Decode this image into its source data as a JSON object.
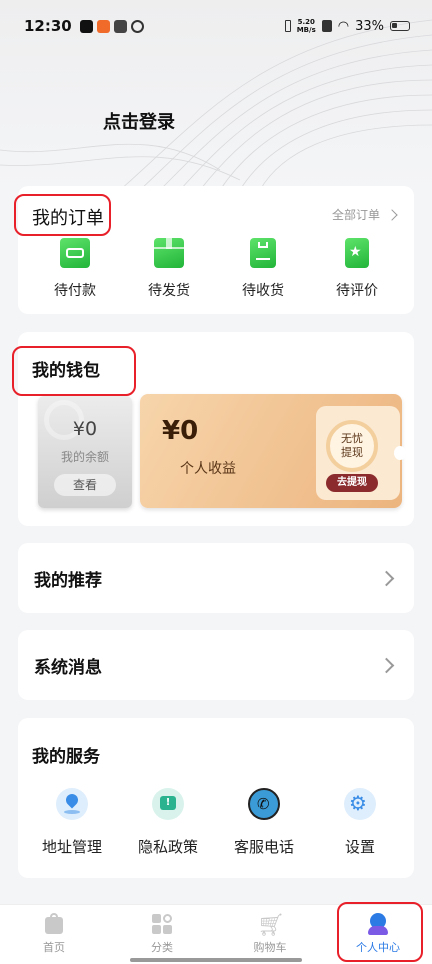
{
  "status_bar": {
    "time": "12:30",
    "net_speed_value": "5.20",
    "net_speed_unit": "MB/s",
    "battery": "33%"
  },
  "header": {
    "login": "点击登录"
  },
  "orders": {
    "title": "我的订单",
    "all_link": "全部订单",
    "items": [
      {
        "label": "待付款",
        "icon": "wallet-icon"
      },
      {
        "label": "待发货",
        "icon": "box-icon"
      },
      {
        "label": "待收货",
        "icon": "package-receive-icon"
      },
      {
        "label": "待评价",
        "icon": "star-review-icon"
      }
    ]
  },
  "wallet": {
    "title": "我的钱包",
    "balance_amount": "¥0",
    "balance_label": "我的余额",
    "balance_button": "查看",
    "income_amount": "¥0",
    "income_label": "个人收益",
    "ticket_line1": "无忧",
    "ticket_line2": "提现",
    "withdraw_button": "去提现"
  },
  "recommend": {
    "title": "我的推荐"
  },
  "messages": {
    "title": "系统消息"
  },
  "services": {
    "title": "我的服务",
    "items": [
      {
        "label": "地址管理",
        "icon": "location-pin-icon"
      },
      {
        "label": "隐私政策",
        "icon": "privacy-alert-icon"
      },
      {
        "label": "客服电话",
        "icon": "phone-icon"
      },
      {
        "label": "设置",
        "icon": "gear-icon"
      }
    ]
  },
  "tabbar": {
    "items": [
      {
        "label": "首页",
        "icon": "home-bag-icon",
        "active": false
      },
      {
        "label": "分类",
        "icon": "category-grid-icon",
        "active": false
      },
      {
        "label": "购物车",
        "icon": "cart-icon",
        "active": false
      },
      {
        "label": "个人中心",
        "icon": "profile-icon",
        "active": true
      }
    ]
  },
  "colors": {
    "annotation_red": "#e8202a",
    "active_tab": "#2c7be5",
    "order_icon_green": "#2fc247",
    "withdraw_button": "#8c2b2e"
  }
}
